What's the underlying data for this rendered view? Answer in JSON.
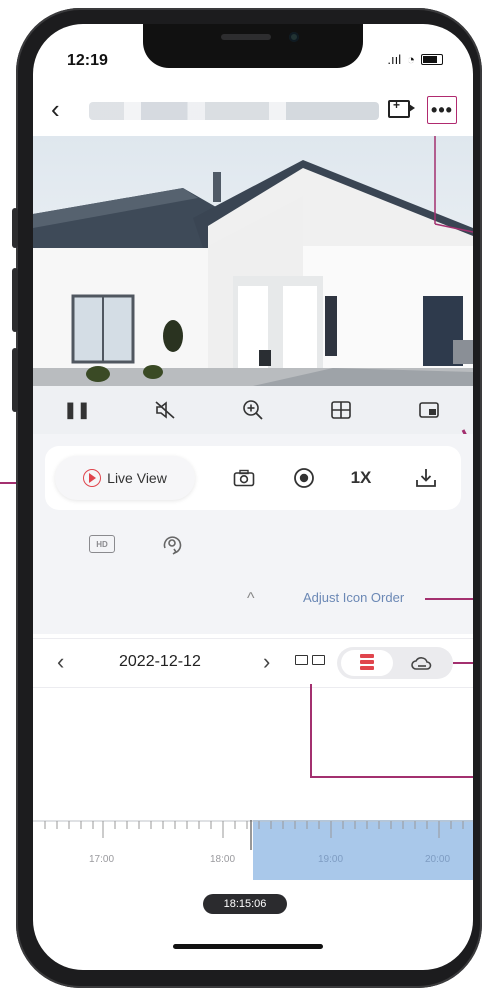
{
  "status_bar": {
    "time": "12:19",
    "signal": ".ııl",
    "wifi": "◔"
  },
  "header": {
    "back_glyph": "‹",
    "more_glyph": "•••"
  },
  "player_controls": [
    {
      "name": "pause-icon",
      "glyph": "❚❚"
    },
    {
      "name": "mute-icon",
      "glyph": "🔇"
    },
    {
      "name": "zoom-in-icon",
      "glyph": "⊕"
    },
    {
      "name": "multi-view-icon",
      "glyph": "⊞"
    },
    {
      "name": "picture-in-picture-icon",
      "glyph": "⧉"
    }
  ],
  "actions": {
    "live_view_label": "Live View",
    "speed_label": "1X",
    "hd_label": "HD",
    "adjust_icon_order": "Adjust Icon Order",
    "collapse_glyph": "^"
  },
  "date_bar": {
    "prev_glyph": "‹",
    "date": "2022-12-12",
    "next_glyph": "›"
  },
  "timeline": {
    "labels": [
      "17:00",
      "18:00",
      "19:00",
      "20:00"
    ],
    "current_time": "18:15:06"
  },
  "colors": {
    "accent_red": "#e0454d",
    "link_blue": "#6b88b5",
    "timeline_highlight": "#a9c8ea",
    "callout": "#a3306f"
  }
}
